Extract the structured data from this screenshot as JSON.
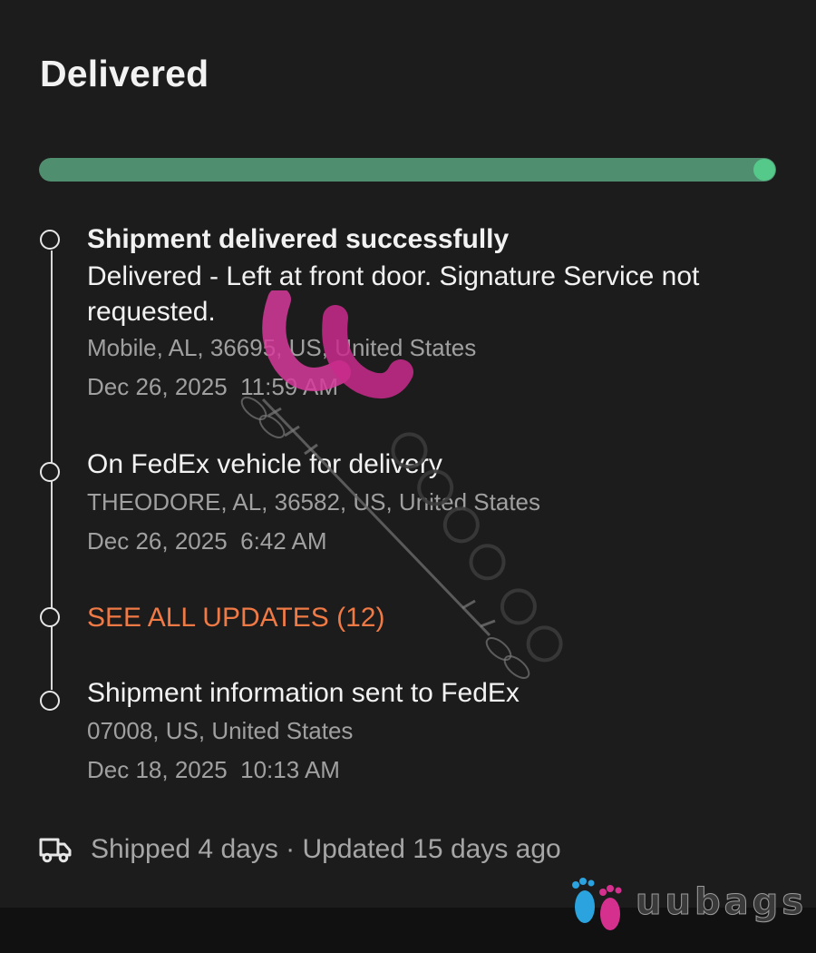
{
  "header": {
    "title": "Delivered"
  },
  "progress": {
    "fraction": 1.0,
    "fill_color": "#4f8f6f",
    "dot_color": "#55c98a"
  },
  "events": [
    {
      "title": "Shipment delivered successfully",
      "description": "Delivered - Left at front door. Signature Service not requested.",
      "location": "Mobile, AL, 36695, US, United States",
      "datetime": "Dec 26, 2025  11:59 AM"
    },
    {
      "title": "On FedEx vehicle for delivery",
      "location": "THEODORE, AL, 36582, US, United States",
      "datetime": "Dec 26, 2025  6:42 AM"
    },
    {
      "title": "Shipment information sent to FedEx",
      "location": "07008, US, United States",
      "datetime": "Dec 18, 2025  10:13 AM"
    }
  ],
  "see_all": {
    "label": "SEE ALL UPDATES (12)",
    "color": "#f07a45"
  },
  "footer": {
    "icon": "truck-icon",
    "text": "Shipped 4 days · Updated 15 days ago"
  },
  "watermark": {
    "center_icon": "uubags-watermark-logo",
    "corner_brand": "uubags",
    "corner_icon": "baby-feet-icon"
  }
}
